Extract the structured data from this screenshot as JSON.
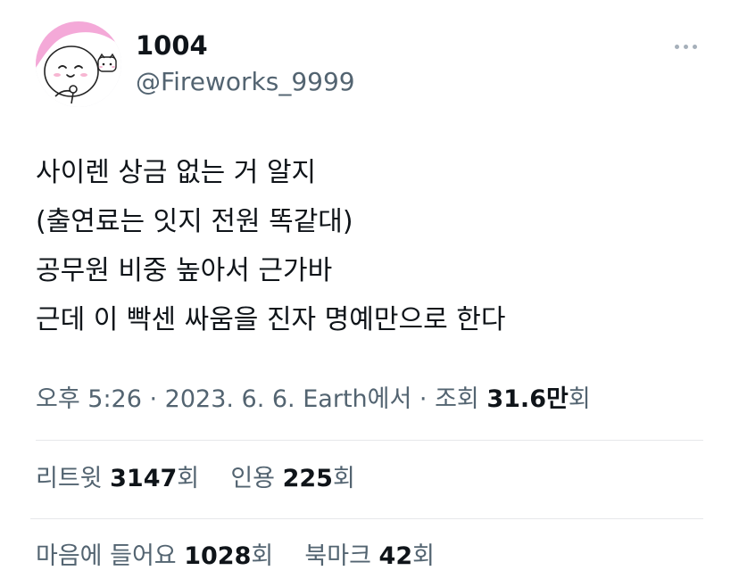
{
  "author": {
    "display_name": "1004",
    "handle": "@Fireworks_9999"
  },
  "tweet": {
    "lines": [
      "사이렌 상금 없는 거 알지",
      "(출연료는 잇지 전원 똑같대)",
      "공무원 비중 높아서 근가바",
      "근데 이 빡센 싸움을 진자 명예만으로 한다"
    ]
  },
  "meta": {
    "time": "오후 5:26",
    "separator": " · ",
    "date": "2023. 6. 6.",
    "source": "Earth에서",
    "views_label": "조회",
    "views_value": "31.6만",
    "views_unit": "회"
  },
  "stats": {
    "retweets": {
      "label": "리트윗",
      "value": "3147",
      "unit": "회"
    },
    "quotes": {
      "label": "인용",
      "value": "225",
      "unit": "회"
    },
    "likes": {
      "label": "마음에 들어요",
      "value": "1028",
      "unit": "회"
    },
    "bookmarks": {
      "label": "북마크",
      "value": "42",
      "unit": "회"
    }
  },
  "icons": {
    "more": "more-horizontal-icon",
    "avatar": "cartoon-character-avatar"
  },
  "colors": {
    "text_primary": "#0f1419",
    "text_secondary": "#536471",
    "avatar_pink": "#f4a9d8",
    "divider": "#e6e8ea"
  }
}
